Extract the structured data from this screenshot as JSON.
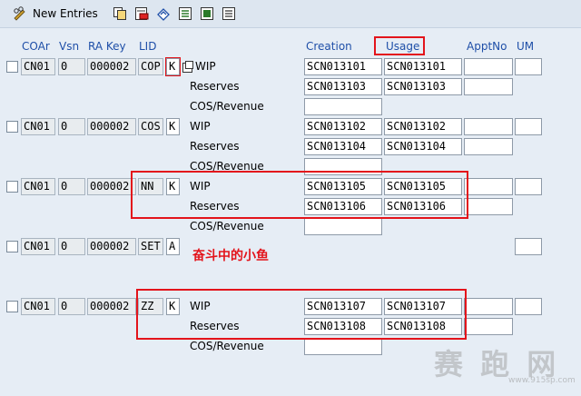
{
  "toolbar": {
    "new_entries_label": "New Entries",
    "icons": [
      "pencil-glasses-icon",
      "copy-icon",
      "delete-icon",
      "undo-icon",
      "select-all-icon",
      "select-block-icon",
      "deselect-all-icon"
    ]
  },
  "headers": {
    "coar": "COAr",
    "vsn": "Vsn",
    "ra_key": "RA Key",
    "lid": "LID",
    "creation": "Creation",
    "usage": "Usage",
    "apptno": "ApptNo",
    "um": "UM"
  },
  "row_labels": {
    "wip": "WIP",
    "reserves": "Reserves",
    "cos": "COS/Revenue"
  },
  "entries": [
    {
      "coar": "CN01",
      "vsn": "0",
      "ra_key": "000002",
      "lid": "COP",
      "flag": "K",
      "wip_creation": "SCN013101",
      "wip_usage": "SCN013101",
      "res_creation": "SCN013103",
      "res_usage": "SCN013103"
    },
    {
      "coar": "CN01",
      "vsn": "0",
      "ra_key": "000002",
      "lid": "COS",
      "flag": "K",
      "wip_creation": "SCN013102",
      "wip_usage": "SCN013102",
      "res_creation": "SCN013104",
      "res_usage": "SCN013104"
    },
    {
      "coar": "CN01",
      "vsn": "0",
      "ra_key": "000002",
      "lid": "NN",
      "flag": "K",
      "wip_creation": "SCN013105",
      "wip_usage": "SCN013105",
      "res_creation": "SCN013106",
      "res_usage": "SCN013106"
    },
    {
      "coar": "CN01",
      "vsn": "0",
      "ra_key": "000002",
      "lid": "SET",
      "flag": "A"
    },
    {
      "coar": "CN01",
      "vsn": "0",
      "ra_key": "000002",
      "lid": "ZZ",
      "flag": "K",
      "wip_creation": "SCN013107",
      "wip_usage": "SCN013107",
      "res_creation": "SCN013108",
      "res_usage": "SCN013108"
    }
  ],
  "annotation": "奋斗中的小鱼",
  "watermark": {
    "text": "赛 跑 网",
    "url": "www.915sp.com"
  },
  "colors": {
    "highlight": "#e3141b",
    "header_text": "#1f4fa8",
    "background": "#e6edf5"
  }
}
